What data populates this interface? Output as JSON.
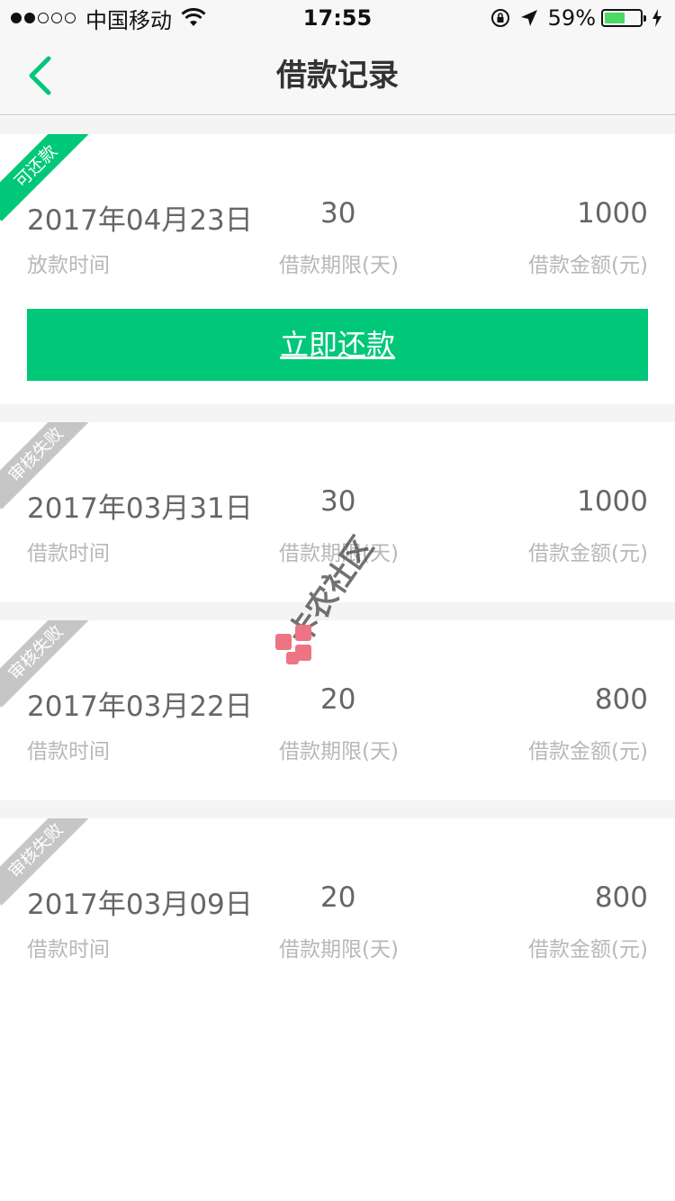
{
  "status_bar": {
    "carrier": "中国移动",
    "time": "17:55",
    "battery": "59%",
    "battery_level": 0.59,
    "signal_bars": 2,
    "signal_total": 5
  },
  "nav": {
    "title": "借款记录",
    "back_icon": "chevron-left-icon"
  },
  "records": [
    {
      "status": "可还款",
      "date": "2017年04月23日",
      "date_label": "放款时间",
      "term": "30",
      "term_label": "借款期限(天)",
      "amount": "1000",
      "amount_label": "借款金额(元)",
      "action_label": "立即还款"
    },
    {
      "status": "审核失败",
      "date": "2017年03月31日",
      "date_label": "借款时间",
      "term": "30",
      "term_label": "借款期限(天)",
      "amount": "1000",
      "amount_label": "借款金额(元)"
    },
    {
      "status": "审核失败",
      "date": "2017年03月22日",
      "date_label": "借款时间",
      "term": "20",
      "term_label": "借款期限(天)",
      "amount": "800",
      "amount_label": "借款金额(元)"
    },
    {
      "status": "审核失败",
      "date": "2017年03月09日",
      "date_label": "借款时间",
      "term": "20",
      "term_label": "借款期限(天)",
      "amount": "800",
      "amount_label": "借款金额(元)"
    }
  ],
  "watermark": {
    "text": "卡农社区"
  },
  "colors": {
    "accent": "#00c878",
    "failed_ribbon": "#c6c6c6",
    "battery": "#4cd964"
  }
}
